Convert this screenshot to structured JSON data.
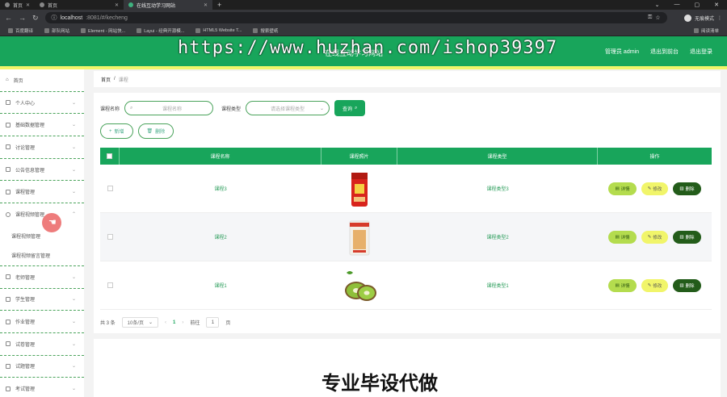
{
  "browser": {
    "tabs": [
      {
        "label": "首页"
      },
      {
        "label": "首页"
      },
      {
        "label": "在线互动学习网站"
      }
    ],
    "url_host": "localhost",
    "url_rest": ":8081/#/kecheng",
    "profile": "无痕模式",
    "bookmarks": [
      "百度翻译",
      "部队网站",
      "Element - 网站快...",
      "Layui - 经典开源模...",
      "HTML5 Website T...",
      "搜索壁纸"
    ],
    "bookmarks_right": "阅读清单"
  },
  "header": {
    "title": "在线互动学习网站",
    "admin": "管理员 admin",
    "back_front": "退出到前台",
    "logout": "退出登录",
    "accent": "#18a55b",
    "accent_line": "#f1f56a"
  },
  "watermark": "https://www.huzhan.com/ishop39397",
  "sidebar": {
    "items": [
      {
        "label": "首页",
        "icon": "home-icon"
      },
      {
        "label": "个人中心",
        "icon": "user-icon"
      },
      {
        "label": "基础数据管理",
        "icon": "database-icon"
      },
      {
        "label": "讨论管理",
        "icon": "chat-icon"
      },
      {
        "label": "公告信息管理",
        "icon": "notice-icon"
      },
      {
        "label": "课程管理",
        "icon": "book-icon"
      },
      {
        "label": "课程视频管理",
        "icon": "video-icon"
      }
    ],
    "subitems": [
      "课程视频管理",
      "课程视频留言管理"
    ],
    "items_after": [
      {
        "label": "老师管理",
        "icon": "teacher-icon"
      },
      {
        "label": "学生管理",
        "icon": "student-icon"
      },
      {
        "label": "作业管理",
        "icon": "homework-icon"
      },
      {
        "label": "试卷管理",
        "icon": "paper-icon"
      },
      {
        "label": "试题管理",
        "icon": "question-icon"
      },
      {
        "label": "考试管理",
        "icon": "exam-icon"
      }
    ]
  },
  "breadcrumb": {
    "home": "首页",
    "sep": "/",
    "current": "课程"
  },
  "search": {
    "name_label": "课程名称",
    "name_placeholder": "课程名称",
    "type_label": "课程类型",
    "type_placeholder": "请选择课程类型",
    "button": "查询"
  },
  "actions": {
    "add": "新增",
    "delete": "删除"
  },
  "table": {
    "headers": [
      "课程名称",
      "课程照片",
      "课程类型",
      "操作"
    ],
    "rows": [
      {
        "name": "课程3",
        "type": "课程类型3",
        "photo": "red-rice-bag"
      },
      {
        "name": "课程2",
        "type": "课程类型2",
        "photo": "grain-bag"
      },
      {
        "name": "课程1",
        "type": "课程类型1",
        "photo": "kiwi-fruit"
      }
    ],
    "ops": {
      "detail": "详情",
      "edit": "修改",
      "del": "删除"
    }
  },
  "pager": {
    "total": "共 3 条",
    "size": "10条/页",
    "page": "1",
    "goto": "前往",
    "goto_value": "1",
    "page_unit": "页"
  },
  "banner": "专业毕设代做"
}
